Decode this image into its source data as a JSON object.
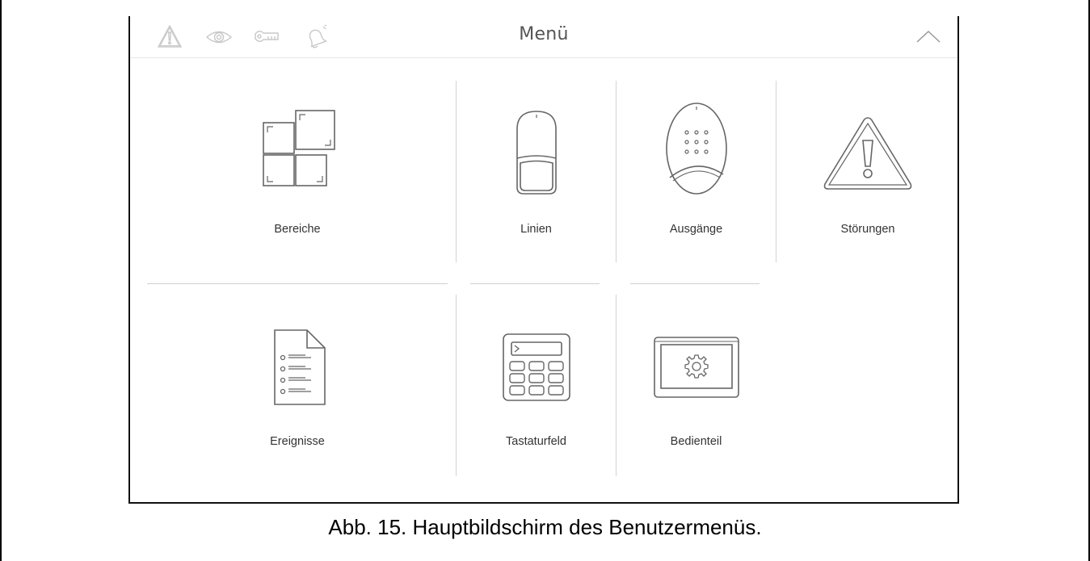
{
  "topbar": {
    "title": "Menü",
    "status_icons": [
      "warning-icon",
      "eye-icon",
      "key-icon",
      "alarm-bell-icon"
    ],
    "collapse_icon": "chevron-up-icon"
  },
  "tiles": [
    {
      "label": "Bereiche",
      "icon": "partitions-icon"
    },
    {
      "label": "Linien",
      "icon": "motion-detector-icon"
    },
    {
      "label": "Ausgänge",
      "icon": "siren-icon"
    },
    {
      "label": "Störungen",
      "icon": "trouble-warning-icon"
    },
    {
      "label": "Ereignisse",
      "icon": "event-log-icon"
    },
    {
      "label": "Tastaturfeld",
      "icon": "keypad-icon"
    },
    {
      "label": "Bedienteil",
      "icon": "touchscreen-settings-icon"
    }
  ],
  "caption": "Abb. 15. Hauptbildschirm des Benutzermenüs.",
  "colors": {
    "icon_stroke": "#666666",
    "status_icon": "#c8c8c8",
    "separator": "#d4d4d4"
  }
}
